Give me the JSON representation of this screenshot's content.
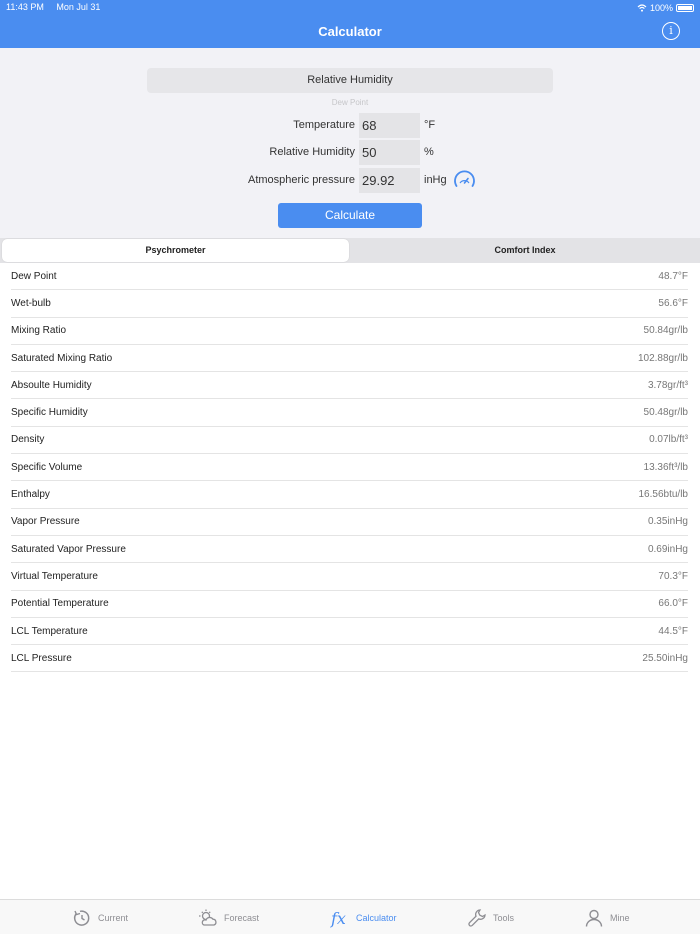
{
  "status_bar": {
    "time": "11:43 PM",
    "date": "Mon Jul 31",
    "battery": "100%"
  },
  "header": {
    "title": "Calculator",
    "info_glyph": "i"
  },
  "picker": {
    "selected": "Relative Humidity",
    "next": "Dew Point"
  },
  "inputs": [
    {
      "label": "Temperature",
      "value": "68",
      "unit": "°F"
    },
    {
      "label": "Relative Humidity",
      "value": "50",
      "unit": "%"
    },
    {
      "label": "Atmospheric pressure",
      "value": "29.92",
      "unit": "inHg"
    }
  ],
  "calculate_label": "Calculate",
  "segments": {
    "active": "Psychrometer",
    "inactive": "Comfort Index"
  },
  "results": [
    {
      "label": "Dew Point",
      "value": "48.7°F"
    },
    {
      "label": "Wet-bulb",
      "value": "56.6°F"
    },
    {
      "label": "Mixing Ratio",
      "value": "50.84gr/lb"
    },
    {
      "label": "Saturated Mixing Ratio",
      "value": "102.88gr/lb"
    },
    {
      "label": "Absoulte Humidity",
      "value": "3.78gr/ft³"
    },
    {
      "label": "Specific Humidity",
      "value": "50.48gr/lb"
    },
    {
      "label": "Density",
      "value": "0.07lb/ft³"
    },
    {
      "label": "Specific Volume",
      "value": "13.36ft³/lb"
    },
    {
      "label": "Enthalpy",
      "value": "16.56btu/lb"
    },
    {
      "label": "Vapor Pressure",
      "value": "0.35inHg"
    },
    {
      "label": "Saturated Vapor Pressure",
      "value": "0.69inHg"
    },
    {
      "label": "Virtual Temperature",
      "value": "70.3°F"
    },
    {
      "label": "Potential Temperature",
      "value": "66.0°F"
    },
    {
      "label": "LCL Temperature",
      "value": "44.5°F"
    },
    {
      "label": "LCL Pressure",
      "value": "25.50inHg"
    }
  ],
  "tabbar": [
    {
      "label": "Current",
      "icon": "refresh-clock-icon"
    },
    {
      "label": "Forecast",
      "icon": "sun-cloud-icon"
    },
    {
      "label": "Calculator",
      "icon": "fx-icon",
      "active": true
    },
    {
      "label": "Tools",
      "icon": "wrench-icon"
    },
    {
      "label": "Mine",
      "icon": "person-icon"
    }
  ],
  "colors": {
    "accent": "#4a8df0",
    "panel": "#f2f2f6"
  }
}
